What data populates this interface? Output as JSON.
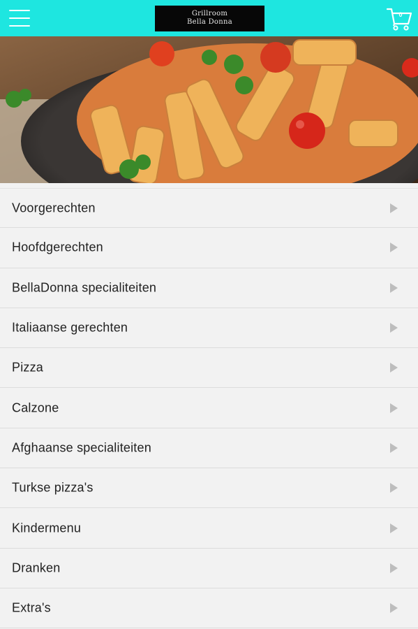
{
  "header": {
    "menu_icon": "hamburger-menu-icon",
    "logo_line1": "Grillroom",
    "logo_line2": "Bella Donna",
    "cart_icon": "shopping-cart-icon",
    "cart_count": "0",
    "background_color": "#1ee6e0"
  },
  "hero": {
    "image": "penne-pasta-with-tomato-sauce-photo"
  },
  "menu": {
    "items": [
      {
        "label": "Voorgerechten"
      },
      {
        "label": "Hoofdgerechten"
      },
      {
        "label": "BellaDonna specialiteiten"
      },
      {
        "label": "Italiaanse gerechten"
      },
      {
        "label": "Pizza"
      },
      {
        "label": "Calzone"
      },
      {
        "label": "Afghaanse specialiteiten"
      },
      {
        "label": "Turkse pizza's"
      },
      {
        "label": "Kindermenu"
      },
      {
        "label": "Dranken"
      },
      {
        "label": "Extra's"
      }
    ],
    "chevron_icon": "chevron-right-icon"
  }
}
